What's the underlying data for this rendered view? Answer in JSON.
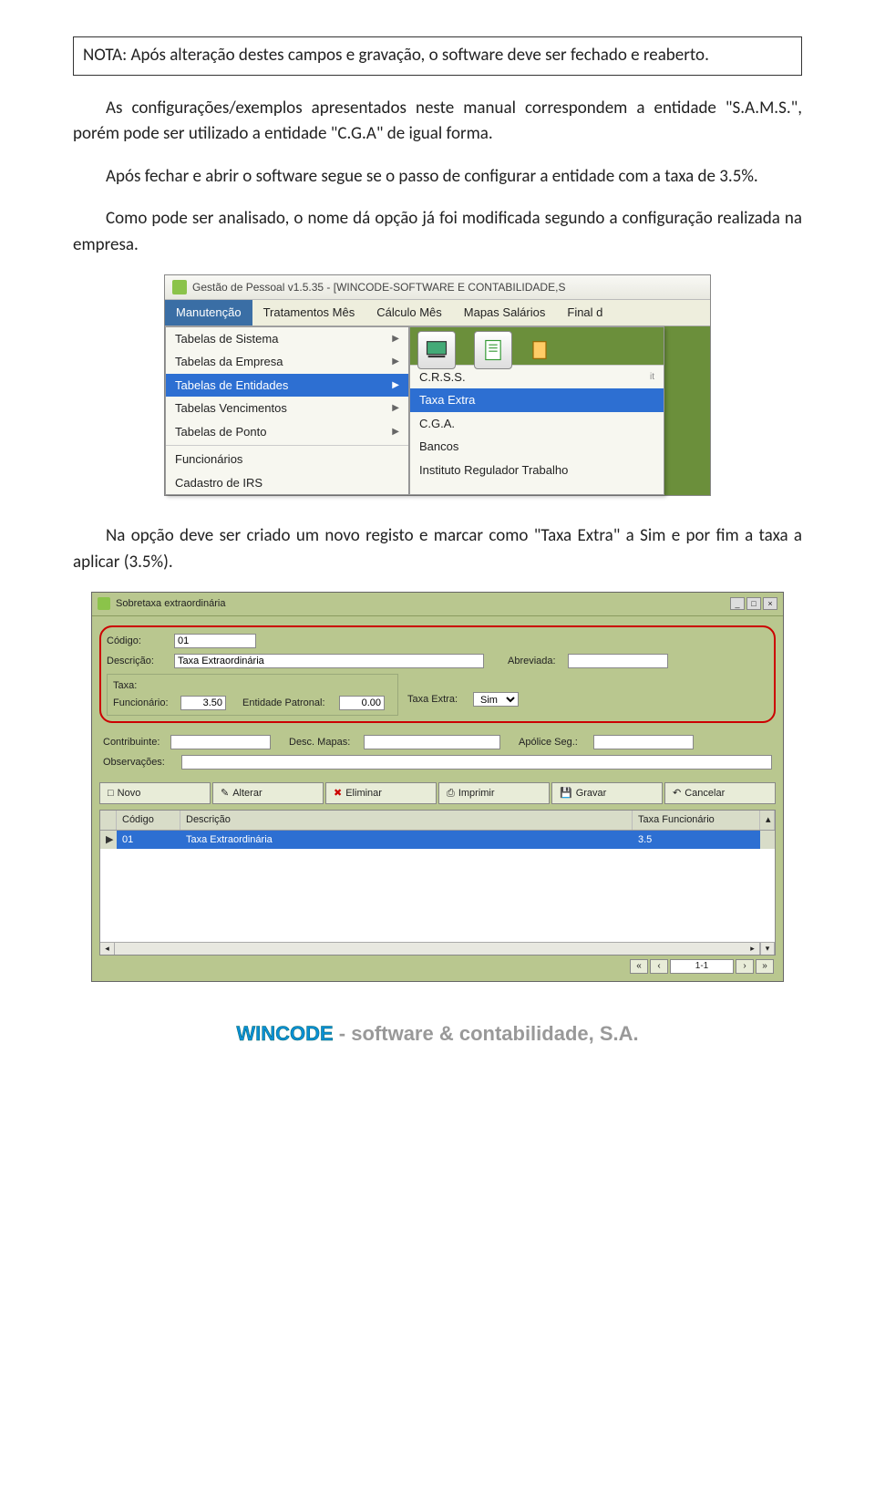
{
  "note": "NOTA: Após alteração destes campos e gravação, o software deve ser fechado e reaberto.",
  "p1": "As configurações/exemplos apresentados neste manual correspondem a entidade \"S.A.M.S.\", porém pode ser utilizado a entidade \"C.G.A\" de igual forma.",
  "p2": "Após fechar e abrir o software segue se o passo de configurar a entidade com a taxa de 3.5%.",
  "p3": "Como pode ser analisado, o nome dá opção já foi modificada segundo a configuração realizada na empresa.",
  "p4": "Na opção deve ser criado um novo registo e marcar como \"Taxa Extra\" a Sim e por fim a taxa a aplicar (3.5%).",
  "shot1": {
    "title": "Gestão de Pessoal v1.5.35 - [WINCODE-SOFTWARE E CONTABILIDADE,S",
    "menu": [
      "Manutenção",
      "Tratamentos Mês",
      "Cálculo Mês",
      "Mapas Salários",
      "Final d"
    ],
    "dropdown": [
      "Tabelas de Sistema",
      "Tabelas da Empresa",
      "Tabelas de Entidades",
      "Tabelas Vencimentos",
      "Tabelas de Ponto",
      "Funcionários",
      "Cadastro de IRS"
    ],
    "submenu": [
      "C.R.S.S.",
      "Taxa Extra",
      "C.G.A.",
      "Bancos",
      "Instituto Regulador Trabalho"
    ]
  },
  "shot2": {
    "title": "Sobretaxa extraordinária",
    "labels": {
      "codigo": "Código:",
      "descricao": "Descrição:",
      "abreviada": "Abreviada:",
      "taxa": "Taxa:",
      "funcionario": "Funcionário:",
      "entidade_patronal": "Entidade Patronal:",
      "taxa_extra": "Taxa Extra:",
      "contribuinte": "Contribuinte:",
      "desc_mapas": "Desc. Mapas:",
      "apolice": "Apólice Seg.:",
      "observacoes": "Observações:"
    },
    "values": {
      "codigo": "01",
      "descricao": "Taxa Extraordinária",
      "abreviada": "",
      "funcionario": "3.50",
      "entidade_patronal": "0.00",
      "taxa_extra": "Sim",
      "contribuinte": "",
      "desc_mapas": "",
      "apolice": "",
      "observacoes": ""
    },
    "buttons": {
      "novo": "Novo",
      "alterar": "Alterar",
      "eliminar": "Eliminar",
      "imprimir": "Imprimir",
      "gravar": "Gravar",
      "cancelar": "Cancelar"
    },
    "grid": {
      "headers": [
        "Código",
        "Descrição",
        "Taxa Funcionário"
      ],
      "row": {
        "codigo": "01",
        "descricao": "Taxa Extraordinária",
        "taxa": "3.5"
      }
    },
    "pager": "1-1"
  },
  "footer": {
    "brand": "WINCODE",
    "dash": " - ",
    "rest": "software & contabilidade, S.A."
  }
}
